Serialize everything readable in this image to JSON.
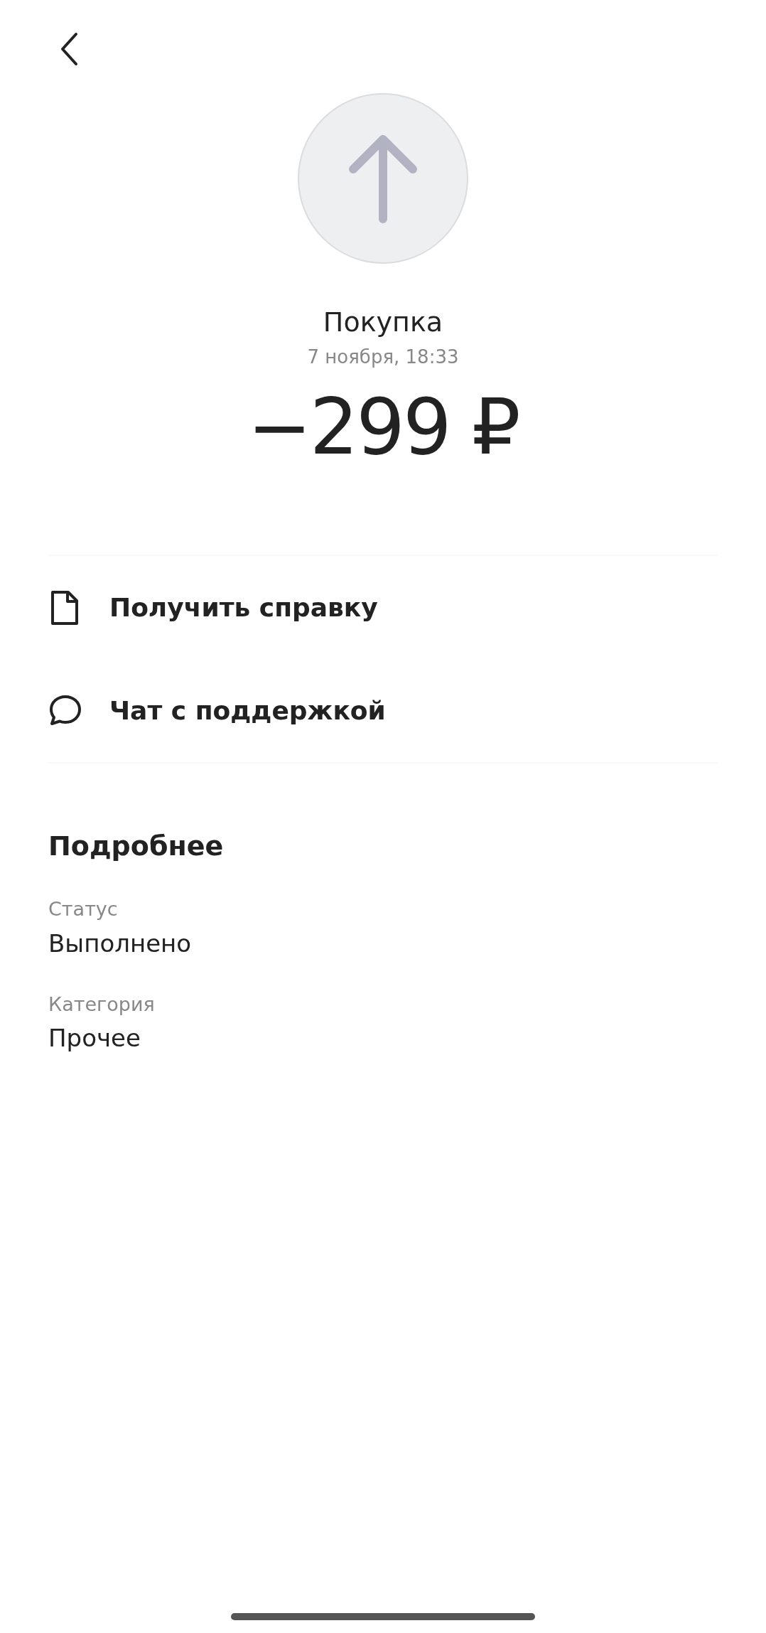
{
  "header": {
    "title": "Покупка",
    "date": "7 ноября, 18:33",
    "amount": "−299 ₽"
  },
  "actions": [
    {
      "kind": "document",
      "label": "Получить справку"
    },
    {
      "kind": "chat",
      "label": "Чат с поддержкой"
    }
  ],
  "details": {
    "title": "Подробнее",
    "fields": [
      {
        "label": "Статус",
        "value": "Выполнено"
      },
      {
        "label": "Категория",
        "value": "Прочее"
      }
    ]
  }
}
